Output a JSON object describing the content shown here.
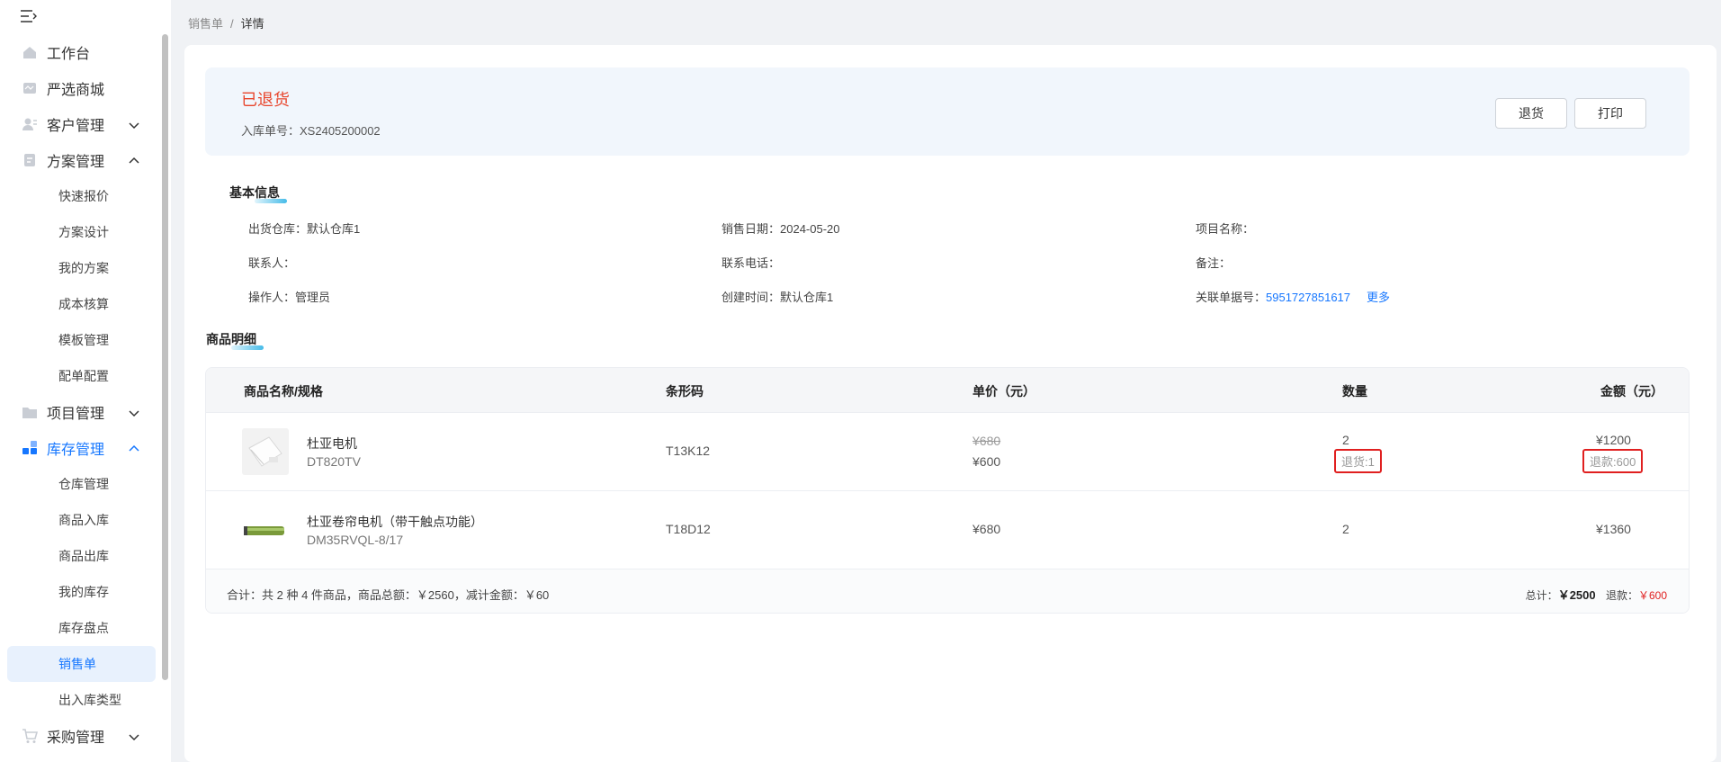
{
  "sidebar": {
    "items": [
      {
        "label": "工作台",
        "icon": "home-icon"
      },
      {
        "label": "严选商城",
        "icon": "store-icon"
      },
      {
        "label": "客户管理",
        "icon": "customer-icon"
      },
      {
        "label": "方案管理",
        "icon": "scheme-icon"
      },
      {
        "label": "项目管理",
        "icon": "folder-icon"
      },
      {
        "label": "库存管理",
        "icon": "inventory-icon"
      },
      {
        "label": "采购管理",
        "icon": "cart-icon"
      }
    ],
    "scheme_sub": [
      "快速报价",
      "方案设计",
      "我的方案",
      "成本核算",
      "模板管理",
      "配单配置"
    ],
    "inventory_sub": [
      "仓库管理",
      "商品入库",
      "商品出库",
      "我的库存",
      "库存盘点",
      "销售单",
      "出入库类型"
    ]
  },
  "breadcrumb": {
    "parent": "销售单",
    "sep": "/",
    "current": "详情"
  },
  "status": {
    "title": "已退货",
    "order_label": "入库单号：",
    "order_no": "XS2405200002",
    "return_button": "退货",
    "print_button": "打印"
  },
  "basic": {
    "title": "基本信息",
    "warehouse": "出货仓库：默认仓库1",
    "sale_date": "销售日期：2024-05-20",
    "project": "项目名称：",
    "contact": "联系人：",
    "phone": "联系电话：",
    "remark": "备注：",
    "operator": "操作人：管理员",
    "created": "创建时间：默认仓库1",
    "related_label": "关联单据号：",
    "related_no": "5951727851617",
    "more": "更多"
  },
  "goods": {
    "title": "商品明细",
    "columns": [
      "商品名称/规格",
      "条形码",
      "单价（元）",
      "数量",
      "金额（元）"
    ],
    "rows": [
      {
        "name": "杜亚电机",
        "spec": "DT820TV",
        "barcode": "T13K12",
        "orig_price": "¥680",
        "price": "¥600",
        "qty": "2",
        "return_qty": "退货:1",
        "amount": "¥1200",
        "refund": "退款:600"
      },
      {
        "name": "杜亚卷帘电机（带干触点功能）",
        "spec": "DM35RVQL-8/17",
        "barcode": "T18D12",
        "price": "¥680",
        "qty": "2",
        "amount": "¥1360"
      }
    ],
    "summary": "合计：共 2 种 4 件商品，商品总额：￥2560，减计金额：￥60",
    "total_label": "总计：",
    "total_value": "￥2500",
    "refund_label": "退款：",
    "refund_value": "￥600"
  }
}
